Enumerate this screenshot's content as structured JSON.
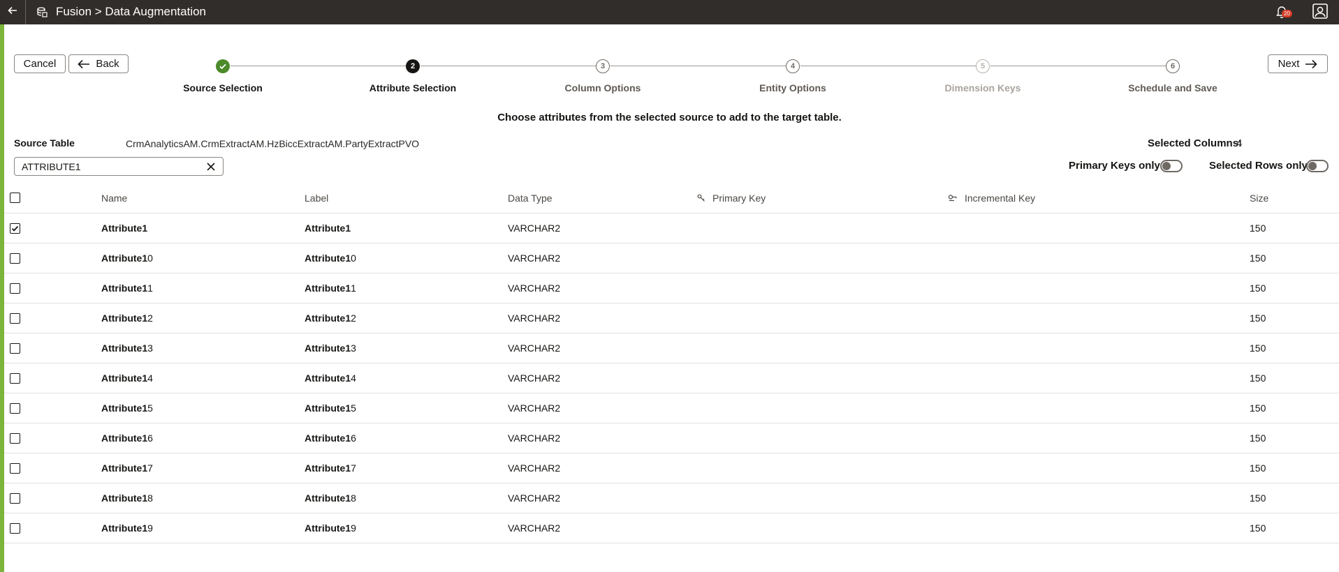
{
  "header": {
    "title": "Fusion > Data Augmentation",
    "notification_count": "20"
  },
  "actions": {
    "cancel_label": "Cancel",
    "back_label": "Back",
    "next_label": "Next"
  },
  "train": {
    "steps": [
      {
        "number": "1",
        "label": "Source Selection",
        "state": "done"
      },
      {
        "number": "2",
        "label": "Attribute Selection",
        "state": "current"
      },
      {
        "number": "3",
        "label": "Column Options",
        "state": "future"
      },
      {
        "number": "4",
        "label": "Entity Options",
        "state": "future"
      },
      {
        "number": "5",
        "label": "Dimension Keys",
        "state": "disabled"
      },
      {
        "number": "6",
        "label": "Schedule and Save",
        "state": "future"
      }
    ]
  },
  "instruction": "Choose attributes from the selected source to add to the target table.",
  "source": {
    "label": "Source Table",
    "value": "CrmAnalyticsAM.CrmExtractAM.HzBiccExtractAM.PartyExtractPVO"
  },
  "selected_columns": {
    "label": "Selected Columns:",
    "value": "4"
  },
  "search": {
    "value": "ATTRIBUTE1"
  },
  "filters": {
    "primary_keys_label": "Primary Keys only",
    "primary_keys_on": false,
    "selected_rows_label": "Selected Rows only",
    "selected_rows_on": false
  },
  "table": {
    "columns": {
      "name": "Name",
      "label": "Label",
      "data_type": "Data Type",
      "primary_key": "Primary Key",
      "incremental_key": "Incremental Key",
      "size": "Size"
    },
    "rows": [
      {
        "checked": true,
        "name_match": "Attribute1",
        "name_rest": "",
        "label_match": "Attribute1",
        "label_rest": "",
        "data_type": "VARCHAR2",
        "size": "150"
      },
      {
        "checked": false,
        "name_match": "Attribute1",
        "name_rest": "0",
        "label_match": "Attribute1",
        "label_rest": "0",
        "data_type": "VARCHAR2",
        "size": "150"
      },
      {
        "checked": false,
        "name_match": "Attribute1",
        "name_rest": "1",
        "label_match": "Attribute1",
        "label_rest": "1",
        "data_type": "VARCHAR2",
        "size": "150"
      },
      {
        "checked": false,
        "name_match": "Attribute1",
        "name_rest": "2",
        "label_match": "Attribute1",
        "label_rest": "2",
        "data_type": "VARCHAR2",
        "size": "150"
      },
      {
        "checked": false,
        "name_match": "Attribute1",
        "name_rest": "3",
        "label_match": "Attribute1",
        "label_rest": "3",
        "data_type": "VARCHAR2",
        "size": "150"
      },
      {
        "checked": false,
        "name_match": "Attribute1",
        "name_rest": "4",
        "label_match": "Attribute1",
        "label_rest": "4",
        "data_type": "VARCHAR2",
        "size": "150"
      },
      {
        "checked": false,
        "name_match": "Attribute1",
        "name_rest": "5",
        "label_match": "Attribute1",
        "label_rest": "5",
        "data_type": "VARCHAR2",
        "size": "150"
      },
      {
        "checked": false,
        "name_match": "Attribute1",
        "name_rest": "6",
        "label_match": "Attribute1",
        "label_rest": "6",
        "data_type": "VARCHAR2",
        "size": "150"
      },
      {
        "checked": false,
        "name_match": "Attribute1",
        "name_rest": "7",
        "label_match": "Attribute1",
        "label_rest": "7",
        "data_type": "VARCHAR2",
        "size": "150"
      },
      {
        "checked": false,
        "name_match": "Attribute1",
        "name_rest": "8",
        "label_match": "Attribute1",
        "label_rest": "8",
        "data_type": "VARCHAR2",
        "size": "150"
      },
      {
        "checked": false,
        "name_match": "Attribute1",
        "name_rest": "9",
        "label_match": "Attribute1",
        "label_rest": "9",
        "data_type": "VARCHAR2",
        "size": "150"
      }
    ]
  },
  "icons": {
    "back": "arrow-left-icon",
    "app": "data-augmentation-icon",
    "notifications": "bell-icon",
    "profile": "user-profile-icon",
    "primary_key": "key-icon",
    "incremental_key": "incremental-key-icon",
    "clear": "close-icon"
  },
  "colors": {
    "topbar": "#312d2a",
    "accent": "#7cb53b",
    "step_done": "#4c8a2a",
    "badge": "#d63b25"
  }
}
